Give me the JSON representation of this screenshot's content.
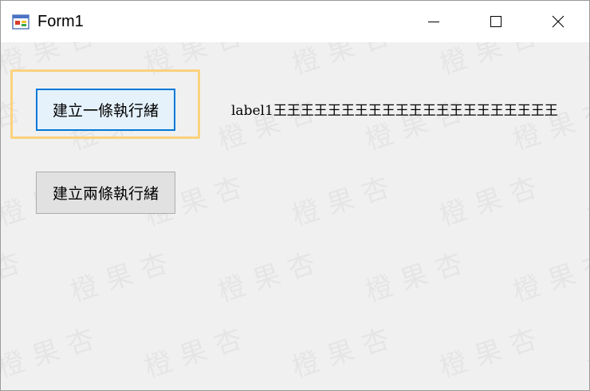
{
  "window": {
    "title": "Form1"
  },
  "buttons": {
    "create_one_thread": "建立一條執行緒",
    "create_two_threads": "建立兩條執行緒"
  },
  "label1": {
    "text": "label1王王王王王王王王王王王王王王王王王王王王王"
  },
  "watermark": {
    "text": "橙果杏"
  },
  "colors": {
    "highlight": "#fcd27c",
    "focus_border": "#0078d7",
    "focus_fill": "#e5f1fb",
    "button_fill": "#e1e1e1",
    "client_bg": "#f0f0f0"
  },
  "icons": {
    "app": "winforms-app-icon",
    "minimize": "minimize-icon",
    "maximize": "maximize-icon",
    "close": "close-icon"
  }
}
